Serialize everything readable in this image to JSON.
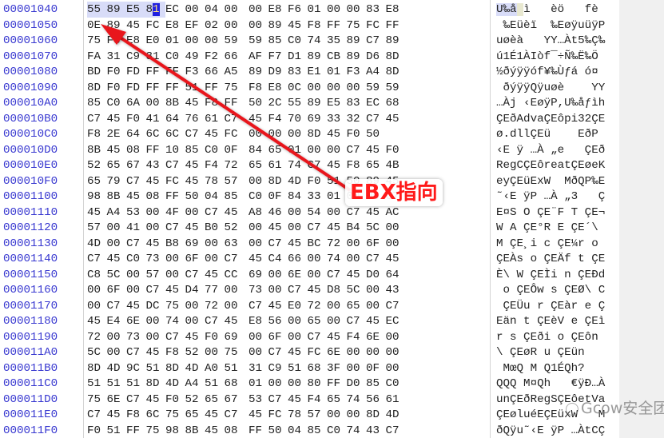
{
  "hex_editor": {
    "rows": [
      {
        "addr": "00001040",
        "bytes": [
          "55",
          "89",
          "E5",
          "81",
          "EC",
          "00",
          "04",
          "00",
          "00",
          "E8",
          "F6",
          "01",
          "00",
          "00",
          "83",
          "E8"
        ],
        "ascii": "U‰å ì   èö   fè"
      },
      {
        "addr": "00001050",
        "bytes": [
          "0E",
          "89",
          "45",
          "FC",
          "E8",
          "EF",
          "02",
          "00",
          "00",
          "89",
          "45",
          "F8",
          "FF",
          "75",
          "FC",
          "FF"
        ],
        "ascii": " ‰Eüèï  ‰EøÿuüÿP"
      },
      {
        "addr": "00001060",
        "bytes": [
          "75",
          "F8",
          "E8",
          "E0",
          "01",
          "00",
          "00",
          "59",
          "59",
          "85",
          "C0",
          "74",
          "35",
          "89",
          "C7",
          "89"
        ],
        "ascii": "uøèà   YY…Àt5‰Ç‰"
      },
      {
        "addr": "00001070",
        "bytes": [
          "FA",
          "31",
          "C9",
          "31",
          "C0",
          "49",
          "F2",
          "66",
          "AF",
          "F7",
          "D1",
          "89",
          "CB",
          "89",
          "D6",
          "8D"
        ],
        "ascii": "ú1É1ÀIòf¯÷Ñ‰Ë‰Ö"
      },
      {
        "addr": "00001080",
        "bytes": [
          "BD",
          "F0",
          "FD",
          "FF",
          "FF",
          "F3",
          "66",
          "A5",
          "89",
          "D9",
          "83",
          "E1",
          "01",
          "F3",
          "A4",
          "8D"
        ],
        "ascii": "½ðýÿÿóf¥‰Ùƒá ó¤"
      },
      {
        "addr": "00001090",
        "bytes": [
          "8D",
          "F0",
          "FD",
          "FF",
          "FF",
          "51",
          "FF",
          "75",
          "F8",
          "E8",
          "0C",
          "00",
          "00",
          "00",
          "59",
          "59"
        ],
        "ascii": " ðýÿÿQÿuøè    YY"
      },
      {
        "addr": "000010A0",
        "bytes": [
          "85",
          "C0",
          "6A",
          "00",
          "8B",
          "45",
          "F8",
          "FF",
          "50",
          "2C",
          "55",
          "89",
          "E5",
          "83",
          "EC",
          "68"
        ],
        "ascii": "…Àj ‹EøÿP,U‰åƒìh"
      },
      {
        "addr": "000010B0",
        "bytes": [
          "C7",
          "45",
          "F0",
          "41",
          "64",
          "76",
          "61",
          "C7",
          "45",
          "F4",
          "70",
          "69",
          "33",
          "32",
          "C7",
          "45"
        ],
        "ascii": "ÇEðAdvaÇEôpi32ÇE"
      },
      {
        "addr": "000010C0",
        "bytes": [
          "F8",
          "2E",
          "64",
          "6C",
          "6C",
          "C7",
          "45",
          "FC",
          "00",
          "00",
          "00",
          "8D",
          "45",
          "F0",
          "50"
        ],
        "ascii": "ø.dllÇEü    EðP"
      },
      {
        "addr": "000010D0",
        "bytes": [
          "8B",
          "45",
          "08",
          "FF",
          "10",
          "85",
          "C0",
          "0F",
          "84",
          "65",
          "01",
          "00",
          "00",
          "C7",
          "45",
          "F0"
        ],
        "ascii": "‹E ÿ …À „e   ÇEð"
      },
      {
        "addr": "000010E0",
        "bytes": [
          "52",
          "65",
          "67",
          "43",
          "C7",
          "45",
          "F4",
          "72",
          "65",
          "61",
          "74",
          "C7",
          "45",
          "F8",
          "65",
          "4B"
        ],
        "ascii": "RegCÇEôreatÇEøeK"
      },
      {
        "addr": "000010F0",
        "bytes": [
          "65",
          "79",
          "C7",
          "45",
          "FC",
          "45",
          "78",
          "57",
          "00",
          "8D",
          "4D",
          "F0",
          "51",
          "50",
          "89",
          "45"
        ],
        "ascii": "eyÇEüExW  MðQP‰E"
      },
      {
        "addr": "00001100",
        "bytes": [
          "98",
          "8B",
          "45",
          "08",
          "FF",
          "50",
          "04",
          "85",
          "C0",
          "0F",
          "84",
          "33",
          "01",
          "00",
          "00",
          "C7"
        ],
        "ascii": "˜‹E ÿP …À „3   Ç"
      },
      {
        "addr": "00001110",
        "bytes": [
          "45",
          "A4",
          "53",
          "00",
          "4F",
          "00",
          "C7",
          "45",
          "A8",
          "46",
          "00",
          "54",
          "00",
          "C7",
          "45",
          "AC"
        ],
        "ascii": "E¤S O ÇE¨F T ÇE¬"
      },
      {
        "addr": "00001120",
        "bytes": [
          "57",
          "00",
          "41",
          "00",
          "C7",
          "45",
          "B0",
          "52",
          "00",
          "45",
          "00",
          "C7",
          "45",
          "B4",
          "5C",
          "00"
        ],
        "ascii": "W A ÇE°R E ÇE´\\ "
      },
      {
        "addr": "00001130",
        "bytes": [
          "4D",
          "00",
          "C7",
          "45",
          "B8",
          "69",
          "00",
          "63",
          "00",
          "C7",
          "45",
          "BC",
          "72",
          "00",
          "6F",
          "00"
        ],
        "ascii": "M ÇE¸i c ÇE¼r o "
      },
      {
        "addr": "00001140",
        "bytes": [
          "C7",
          "45",
          "C0",
          "73",
          "00",
          "6F",
          "00",
          "C7",
          "45",
          "C4",
          "66",
          "00",
          "74",
          "00",
          "C7",
          "45"
        ],
        "ascii": "ÇEÀs o ÇEÄf t ÇE"
      },
      {
        "addr": "00001150",
        "bytes": [
          "C8",
          "5C",
          "00",
          "57",
          "00",
          "C7",
          "45",
          "CC",
          "69",
          "00",
          "6E",
          "00",
          "C7",
          "45",
          "D0",
          "64"
        ],
        "ascii": "È\\ W ÇEÌi n ÇEÐd"
      },
      {
        "addr": "00001160",
        "bytes": [
          "00",
          "6F",
          "00",
          "C7",
          "45",
          "D4",
          "77",
          "00",
          "73",
          "00",
          "C7",
          "45",
          "D8",
          "5C",
          "00",
          "43"
        ],
        "ascii": " o ÇEÔw s ÇEØ\\ C"
      },
      {
        "addr": "00001170",
        "bytes": [
          "00",
          "C7",
          "45",
          "DC",
          "75",
          "00",
          "72",
          "00",
          "C7",
          "45",
          "E0",
          "72",
          "00",
          "65",
          "00",
          "C7"
        ],
        "ascii": " ÇEÜu r ÇEàr e Ç"
      },
      {
        "addr": "00001180",
        "bytes": [
          "45",
          "E4",
          "6E",
          "00",
          "74",
          "00",
          "C7",
          "45",
          "E8",
          "56",
          "00",
          "65",
          "00",
          "C7",
          "45",
          "EC"
        ],
        "ascii": "Eän t ÇEèV e ÇEì"
      },
      {
        "addr": "00001190",
        "bytes": [
          "72",
          "00",
          "73",
          "00",
          "C7",
          "45",
          "F0",
          "69",
          "00",
          "6F",
          "00",
          "C7",
          "45",
          "F4",
          "6E",
          "00"
        ],
        "ascii": "r s ÇEði o ÇEôn "
      },
      {
        "addr": "000011A0",
        "bytes": [
          "5C",
          "00",
          "C7",
          "45",
          "F8",
          "52",
          "00",
          "75",
          "00",
          "C7",
          "45",
          "FC",
          "6E",
          "00",
          "00",
          "00"
        ],
        "ascii": "\\ ÇEøR u ÇEün   "
      },
      {
        "addr": "000011B0",
        "bytes": [
          "8D",
          "4D",
          "9C",
          "51",
          "8D",
          "4D",
          "A0",
          "51",
          "31",
          "C9",
          "51",
          "68",
          "3F",
          "00",
          "0F",
          "00"
        ],
        "ascii": " MœQ M Q1ÉQh?   "
      },
      {
        "addr": "000011C0",
        "bytes": [
          "51",
          "51",
          "51",
          "8D",
          "4D",
          "A4",
          "51",
          "68",
          "01",
          "00",
          "00",
          "80",
          "FF",
          "D0",
          "85",
          "C0"
        ],
        "ascii": "QQQ M¤Qh   €ÿÐ…À"
      },
      {
        "addr": "000011D0",
        "bytes": [
          "75",
          "6E",
          "C7",
          "45",
          "F0",
          "52",
          "65",
          "67",
          "53",
          "C7",
          "45",
          "F4",
          "65",
          "74",
          "56",
          "61"
        ],
        "ascii": "unÇEðRegSÇEôetVa"
      },
      {
        "addr": "000011E0",
        "bytes": [
          "C7",
          "45",
          "F8",
          "6C",
          "75",
          "65",
          "45",
          "C7",
          "45",
          "FC",
          "78",
          "57",
          "00",
          "00",
          "8D",
          "4D"
        ],
        "ascii": "ÇEøluéEÇEüxW   M"
      },
      {
        "addr": "000011F0",
        "bytes": [
          "F0",
          "51",
          "FF",
          "75",
          "98",
          "8B",
          "45",
          "08",
          "FF",
          "50",
          "04",
          "85",
          "C0",
          "74",
          "43",
          "C7"
        ],
        "ascii": "ðQÿu˜‹E ÿP …ÀtCÇ"
      }
    ],
    "selection": {
      "row": 0,
      "selected_bytes": 4,
      "cursor_byte": 3
    }
  },
  "annotation": {
    "label": "EBX指向",
    "color": "#ff1a1a"
  },
  "watermark": {
    "text": "Gcow安全团队"
  },
  "colors": {
    "address": "#3838d0",
    "selection": "#d8dcf8",
    "cursor": "#2020e0"
  }
}
